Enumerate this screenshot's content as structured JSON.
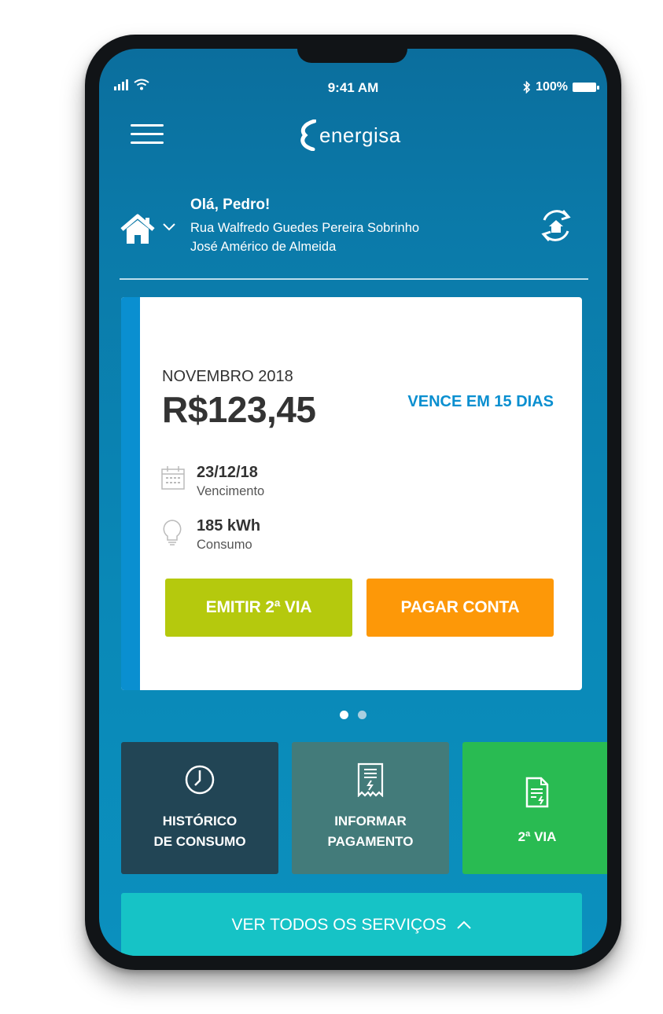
{
  "status_bar": {
    "time": "9:41 AM",
    "battery": "100%"
  },
  "header": {
    "brand": "energisa"
  },
  "account": {
    "greeting": "Olá, Pedro!",
    "address_line1": "Rua Walfredo Guedes Pereira Sobrinho",
    "address_line2": "José Américo de Almeida"
  },
  "bill": {
    "month": "NOVEMBRO 2018",
    "amount": "R$123,45",
    "due_badge": "VENCE EM 15 DIAS",
    "due_date": "23/12/18",
    "due_label": "Vencimento",
    "consumption": "185 kWh",
    "consumption_label": "Consumo",
    "emit_button": "EMITIR 2ª VIA",
    "pay_button": "PAGAR CONTA"
  },
  "carousel": {
    "pages": 2,
    "active": 1
  },
  "tiles": [
    {
      "line1": "HISTÓRICO",
      "line2": "DE CONSUMO",
      "icon": "clock-icon"
    },
    {
      "line1": "INFORMAR",
      "line2": "PAGAMENTO",
      "icon": "receipt-icon"
    },
    {
      "line1": "2ª VIA",
      "icon": "document-icon"
    }
  ],
  "all_services": {
    "label": "VER TODOS OS SERVIÇOS"
  },
  "colors": {
    "brand_blue": "#0b7aa9",
    "accent_blue": "#0a8fd0",
    "emit_green": "#b5c90d",
    "pay_orange": "#fd9808",
    "tile_dark": "#224555",
    "tile_teal": "#437b7a",
    "tile_green": "#29bb52",
    "services_cyan": "#16c3c6"
  }
}
